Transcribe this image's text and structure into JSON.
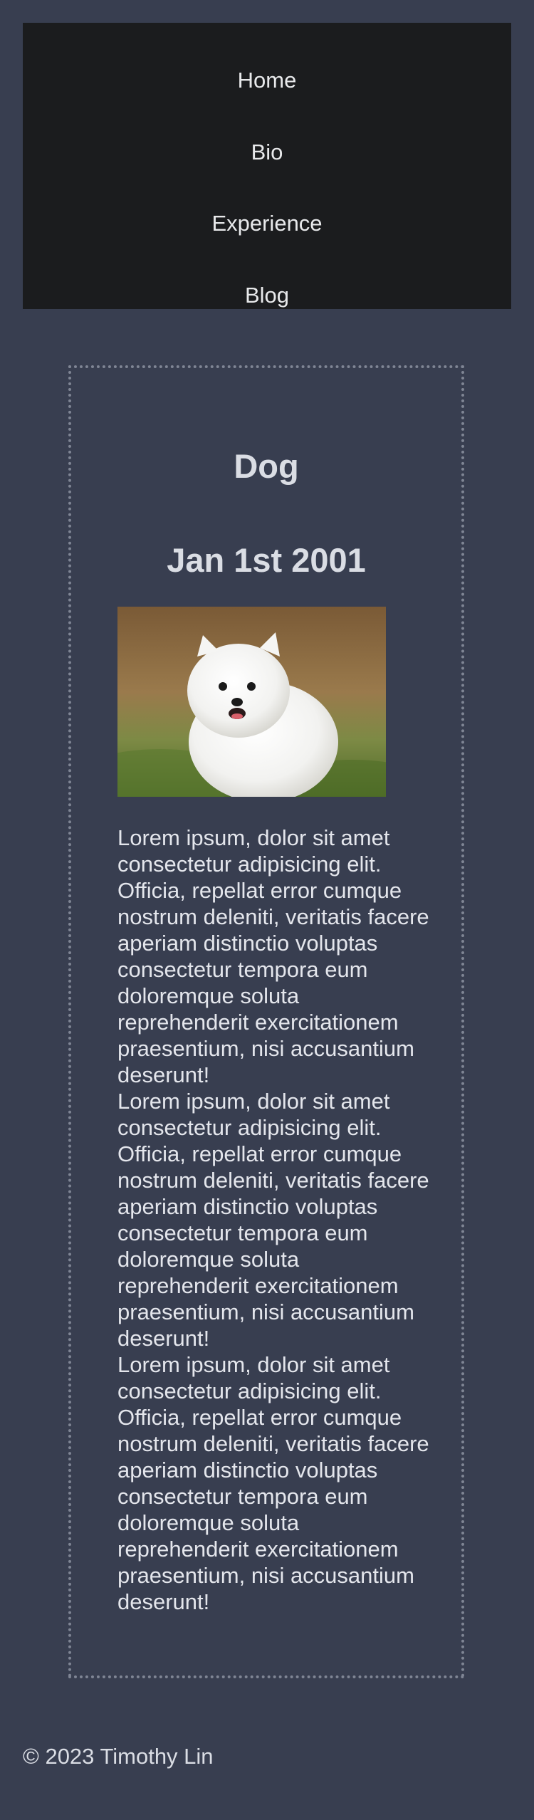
{
  "nav": {
    "items": [
      {
        "label": "Home"
      },
      {
        "label": "Bio"
      },
      {
        "label": "Experience"
      },
      {
        "label": "Blog"
      }
    ]
  },
  "post": {
    "title": "Dog",
    "date": "Jan 1st 2001",
    "paragraphs": [
      "Lorem ipsum, dolor sit amet consectetur adipisicing elit. Officia, repellat error cumque nostrum deleniti, veritatis facere aperiam distinctio voluptas consectetur tempora eum doloremque soluta reprehenderit exercitationem praesentium, nisi accusantium deserunt!",
      "Lorem ipsum, dolor sit amet consectetur adipisicing elit. Officia, repellat error cumque nostrum deleniti, veritatis facere aperiam distinctio voluptas consectetur tempora eum doloremque soluta reprehenderit exercitationem praesentium, nisi accusantium deserunt!",
      "Lorem ipsum, dolor sit amet consectetur adipisicing elit. Officia, repellat error cumque nostrum deleniti, veritatis facere aperiam distinctio voluptas consectetur tempora eum doloremque soluta reprehenderit exercitationem praesentium, nisi accusantium deserunt!"
    ]
  },
  "footer": {
    "text": "© 2023 Timothy Lin"
  }
}
